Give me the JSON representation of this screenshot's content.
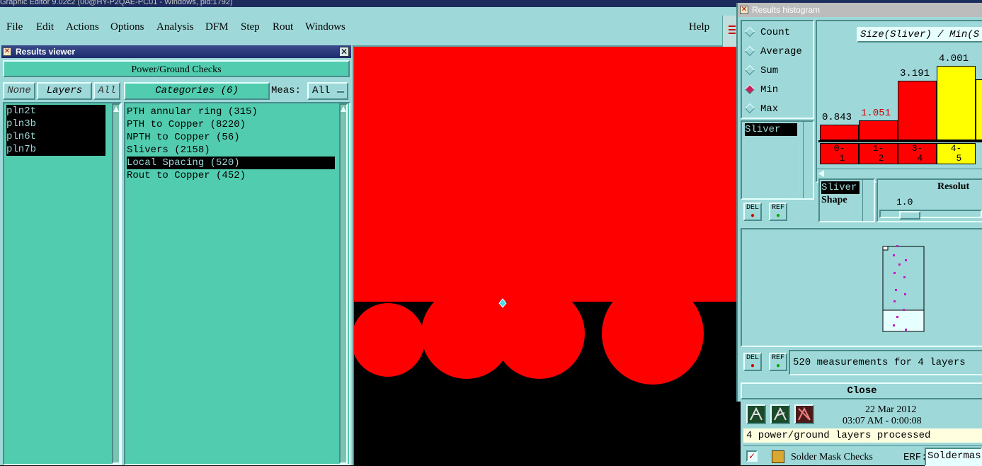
{
  "app": {
    "title": "Graphic Editor 9.02c2 (00@HY-P2QAE-PC01 - Windows, pid:1792)",
    "menus": [
      "File",
      "Edit",
      "Actions",
      "Options",
      "Analysis",
      "DFM",
      "Step",
      "Rout",
      "Windows"
    ],
    "help": "Help"
  },
  "results_viewer": {
    "title": "Results viewer",
    "header": "Power/Ground Checks",
    "none_label": "None",
    "layers_label": "Layers",
    "all_label": "All",
    "layers": [
      "pln2t",
      "pln3b",
      "pln6t",
      "pln7b"
    ],
    "categories_label": "Categories (6)",
    "meas_label": "Meas:",
    "meas_value": "All",
    "categories": [
      {
        "label": "PTH annular ring (315)",
        "selected": false
      },
      {
        "label": "PTH to Copper (8220)",
        "selected": false
      },
      {
        "label": "NPTH to Copper (56)",
        "selected": false
      },
      {
        "label": "Slivers (2158)",
        "selected": false
      },
      {
        "label": "Local Spacing (520)",
        "selected": true
      },
      {
        "label": "Rout to Copper (452)",
        "selected": false
      }
    ]
  },
  "histogram": {
    "title": "Results histogram",
    "modes": [
      {
        "label": "Count",
        "checked": false
      },
      {
        "label": "Average",
        "checked": false
      },
      {
        "label": "Sum",
        "checked": false
      },
      {
        "label": "Min",
        "checked": true
      },
      {
        "label": "Max",
        "checked": false
      }
    ],
    "chart_title": "Size(Sliver) / Min(S",
    "filter_item": "Sliver",
    "list_items": [
      "Sliver",
      "Shape"
    ],
    "resolution_label": "Resolut",
    "resolution_value": "1.0",
    "del_label": "DEL",
    "ref_label": "REF",
    "measurements": "520 measurements for 4 layers",
    "close_label": "Close",
    "chart_data": {
      "type": "bar",
      "categories": [
        "0-1",
        "1-2",
        "3-4",
        "4-5"
      ],
      "values": [
        0.843,
        1.051,
        3.191,
        4.001
      ],
      "value_labels": [
        "0.843",
        "1.051",
        "3.191",
        "4.001"
      ],
      "bin_top": [
        "0-",
        "1-",
        "3-",
        "4-"
      ],
      "bin_bottom": [
        "1",
        "2",
        "4",
        "5"
      ],
      "colors": [
        "#ff0000",
        "#ff0000",
        "#ff0000",
        "#ffff00"
      ],
      "label_colors": [
        "#000000",
        "#cc0000",
        "#000000",
        "#000000"
      ],
      "ylim": [
        0,
        5
      ]
    }
  },
  "status": {
    "date": "22 Mar 2012",
    "time": "03:07 AM - 0:00:08",
    "message": "4 power/ground layers processed",
    "check_name": "Solder Mask Checks",
    "erf_label": "ERF:",
    "erf_value": "Soldermas"
  },
  "colors": {
    "copper_red": "#ff0000",
    "panel_teal": "#9ed8d8",
    "list_green": "#52ccae"
  }
}
